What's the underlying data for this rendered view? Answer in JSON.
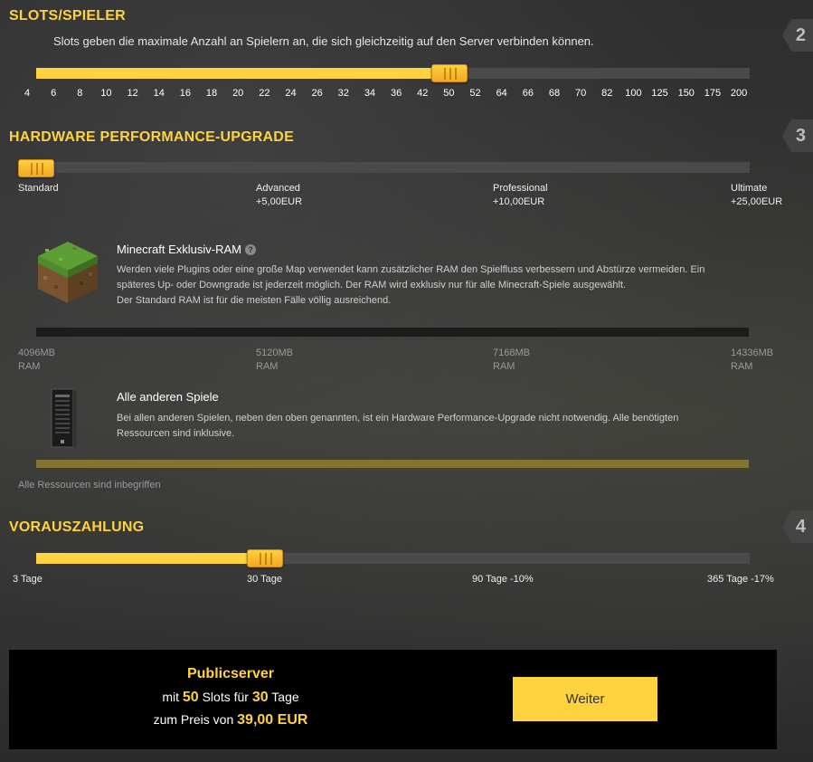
{
  "slots": {
    "title": "SLOTS/SPIELER",
    "step": "2",
    "description": "Slots geben die maximale Anzahl an Spielern an, die sich gleichzeitig auf den Server verbinden können.",
    "ticks": [
      "4",
      "6",
      "8",
      "10",
      "12",
      "14",
      "16",
      "18",
      "20",
      "22",
      "24",
      "26",
      "32",
      "34",
      "36",
      "42",
      "50",
      "52",
      "64",
      "66",
      "68",
      "70",
      "82",
      "100",
      "125",
      "150",
      "175",
      "200"
    ],
    "selected_value": "50",
    "selected_index": 16
  },
  "hardware": {
    "title": "HARDWARE PERFORMANCE-UPGRADE",
    "step": "3",
    "selected_index": 0,
    "options": [
      {
        "name": "Standard",
        "price": ""
      },
      {
        "name": "Advanced",
        "price": "+5,00EUR"
      },
      {
        "name": "Professional",
        "price": "+10,00EUR"
      },
      {
        "name": "Ultimate",
        "price": "+25,00EUR"
      }
    ],
    "minecraft": {
      "title": "Minecraft Exklusiv-RAM",
      "help_icon": "?",
      "text_lines": [
        "Werden viele Plugins oder eine große Map verwendet kann zusätzlicher RAM den Spielfluss verbessern und Abstürze vermeiden. Ein",
        "späteres Up- oder Downgrade ist jederzeit möglich. Der RAM wird exklusiv nur für alle Minecraft-Spiele ausgewählt.",
        "Der Standard RAM ist für die meisten Fälle völlig ausreichend."
      ],
      "ram_levels": [
        {
          "amount": "4096MB",
          "unit": "RAM"
        },
        {
          "amount": "5120MB",
          "unit": "RAM"
        },
        {
          "amount": "7168MB",
          "unit": "RAM"
        },
        {
          "amount": "14336MB",
          "unit": "RAM"
        }
      ]
    },
    "other_games": {
      "title": "Alle anderen Spiele",
      "text_lines": [
        "Bei allen anderen Spielen, neben den oben genannten, ist ein Hardware Performance-Upgrade nicht notwendig. Alle benötigten",
        "Ressourcen sind inklusive."
      ],
      "note": "Alle Ressourcen sind inbegriffen"
    }
  },
  "prepayment": {
    "title": "VORAUSZAHLUNG",
    "step": "4",
    "selected_index": 1,
    "options": [
      "3 Tage",
      "30 Tage",
      "90 Tage -10%",
      "365 Tage -17%"
    ]
  },
  "summary": {
    "plan": "Publicserver",
    "line1_pre": "mit",
    "slots": "50",
    "line1_mid": "Slots für",
    "days": "30",
    "line1_post": "Tage",
    "line2_pre": "zum Preis von",
    "price": "39,00 EUR",
    "button_label": "Weiter"
  },
  "colors": {
    "accent": "#ffd23f",
    "handle": "#f4a821",
    "track": "#4a4a4a",
    "bar_bg": "#000000"
  }
}
